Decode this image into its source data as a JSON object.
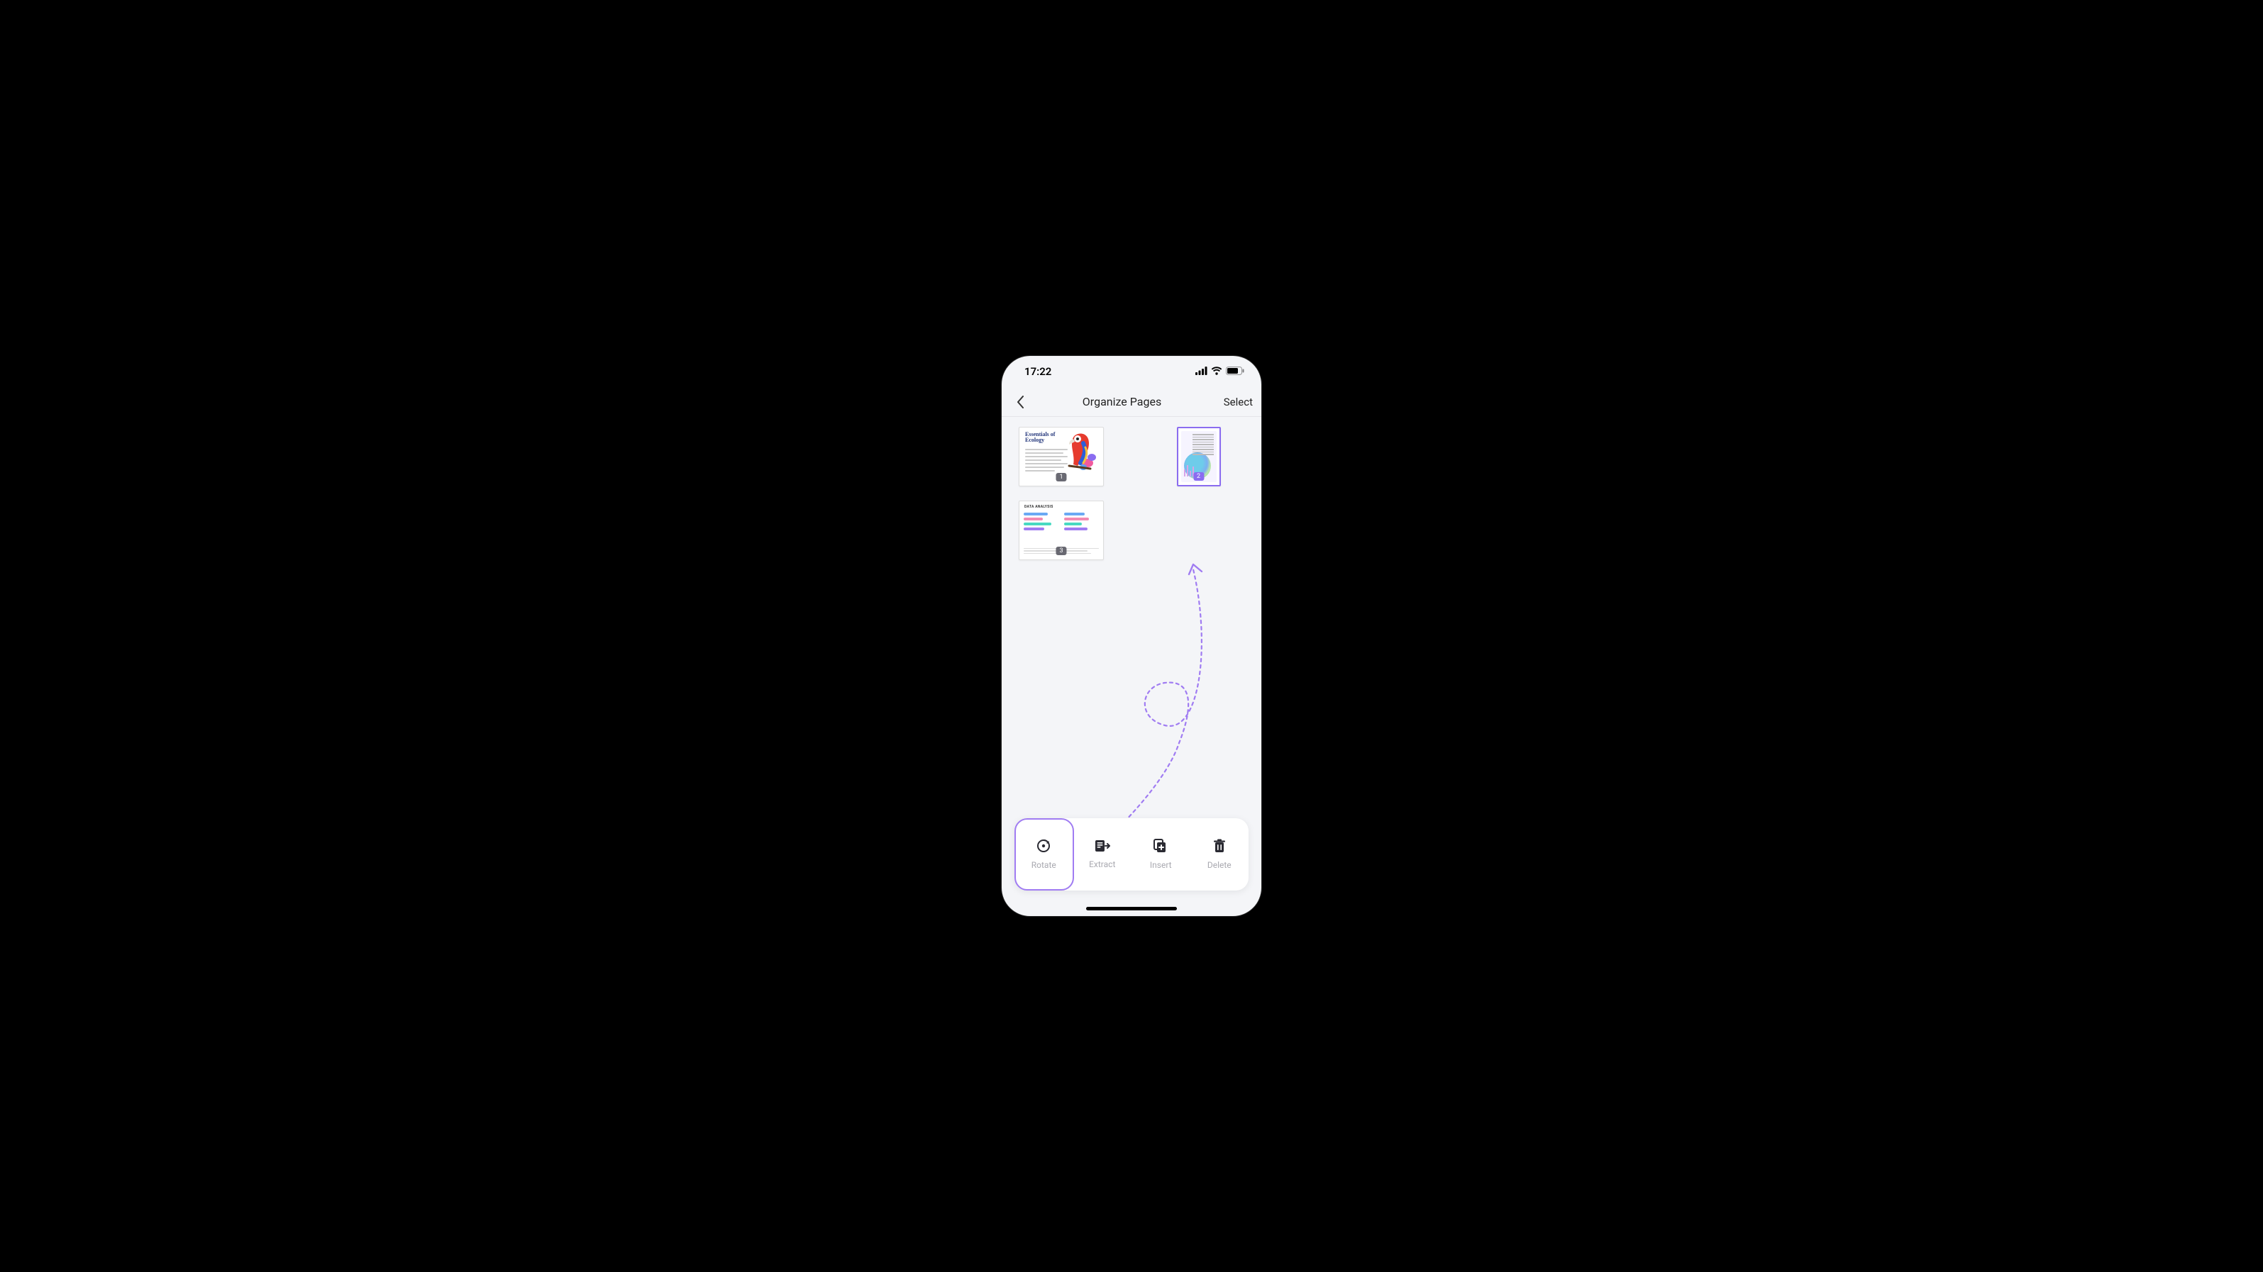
{
  "status": {
    "time": "17:22"
  },
  "nav": {
    "title": "Organize Pages",
    "action": "Select"
  },
  "pages": [
    {
      "index": "1",
      "title": "Essentials of Ecology",
      "selected": false,
      "orientation": "landscape"
    },
    {
      "index": "2",
      "title": "",
      "selected": true,
      "orientation": "portrait"
    },
    {
      "index": "3",
      "title": "DATA ANALYSIS",
      "selected": false,
      "orientation": "landscape"
    }
  ],
  "toolbar": [
    {
      "id": "rotate",
      "label": "Rotate",
      "highlighted": true
    },
    {
      "id": "extract",
      "label": "Extract",
      "highlighted": false
    },
    {
      "id": "insert",
      "label": "Insert",
      "highlighted": false
    },
    {
      "id": "delete",
      "label": "Delete",
      "highlighted": false
    }
  ],
  "colors": {
    "accent": "#8a6cf0"
  }
}
